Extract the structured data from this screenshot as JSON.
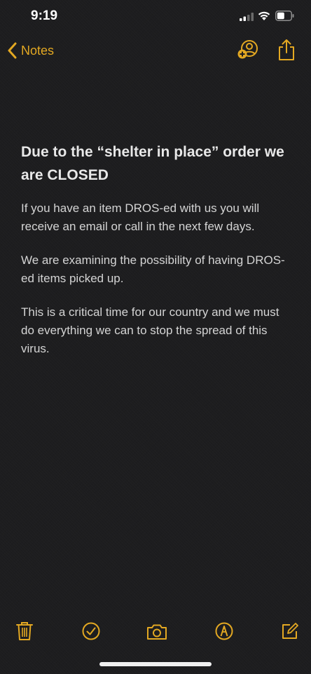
{
  "status_bar": {
    "time": "9:19"
  },
  "nav": {
    "back_label": "Notes"
  },
  "note": {
    "title": "Due to the “shelter in place” order we are CLOSED",
    "paragraphs": [
      "If you have an item DROS-ed with us you will receive an email or call in the next few days.",
      "We are examining the possibility of having DROS-ed items picked up.",
      "This is a critical time for our country and we must do everything we can to stop the spread of this virus."
    ]
  },
  "icons": {
    "back": "chevron-left-icon",
    "collaborate": "add-person-icon",
    "share": "share-icon",
    "trash": "trash-icon",
    "checklist": "checkmark-circle-icon",
    "camera": "camera-icon",
    "markup": "markup-pen-icon",
    "compose": "compose-icon"
  },
  "colors": {
    "accent": "#e3a822",
    "background": "#1d1d1f",
    "text": "#d4d4d4"
  }
}
